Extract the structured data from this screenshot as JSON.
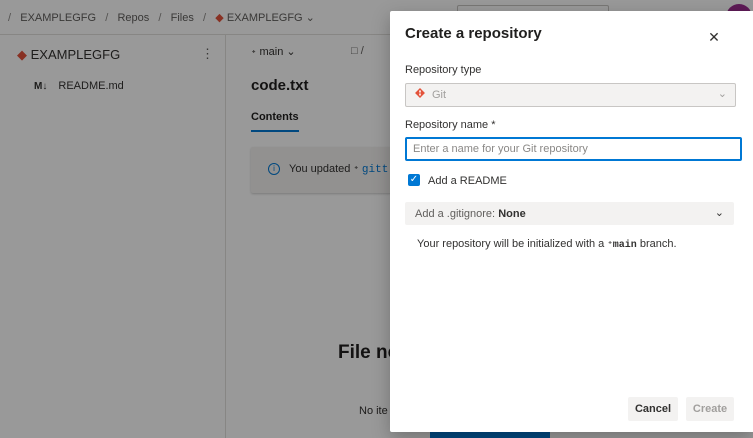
{
  "breadcrumb": {
    "items": [
      "EXAMPLEGFG",
      "Repos",
      "Files",
      "EXAMPLEGFG"
    ],
    "separator": "/"
  },
  "sidebar": {
    "repo_name": "EXAMPLEGFG",
    "more_glyph": "⋮",
    "file_icon_text": "M↓",
    "files": [
      "README.md"
    ]
  },
  "main": {
    "branch_label": "main",
    "file_title": "code.txt",
    "tab_contents": "Contents",
    "info_text_prefix": "You updated",
    "info_link_partial": "gitt",
    "empty_title_partial": "File no",
    "empty_sub_partial": "No ite"
  },
  "dialog": {
    "title": "Create a repository",
    "close_glyph": "✕",
    "repo_type_label": "Repository type",
    "repo_type_value": "Git",
    "repo_name_label": "Repository name *",
    "repo_name_placeholder": "Enter a name for your Git repository",
    "repo_name_value": "",
    "add_readme_label": "Add a README",
    "add_readme_checked": true,
    "gitignore_label": "Add a .gitignore:",
    "gitignore_value": "None",
    "init_note_prefix": "Your repository will be initialized with a",
    "init_note_branch": "main",
    "init_note_suffix": "branch.",
    "cancel_label": "Cancel",
    "create_label": "Create"
  },
  "colors": {
    "accent": "#0078d4",
    "git_brand": "#e3533b",
    "avatar": "#9b2c8f",
    "overlay": "rgba(0,0,0,0.4)"
  },
  "icons": {
    "git": "git-icon",
    "chevron": "chevron-down-icon",
    "branch": "branch-icon",
    "folder": "folder-icon",
    "info": "info-icon",
    "markdown": "markdown-icon",
    "close": "close-icon",
    "more": "more-icon",
    "check": "check-icon"
  }
}
